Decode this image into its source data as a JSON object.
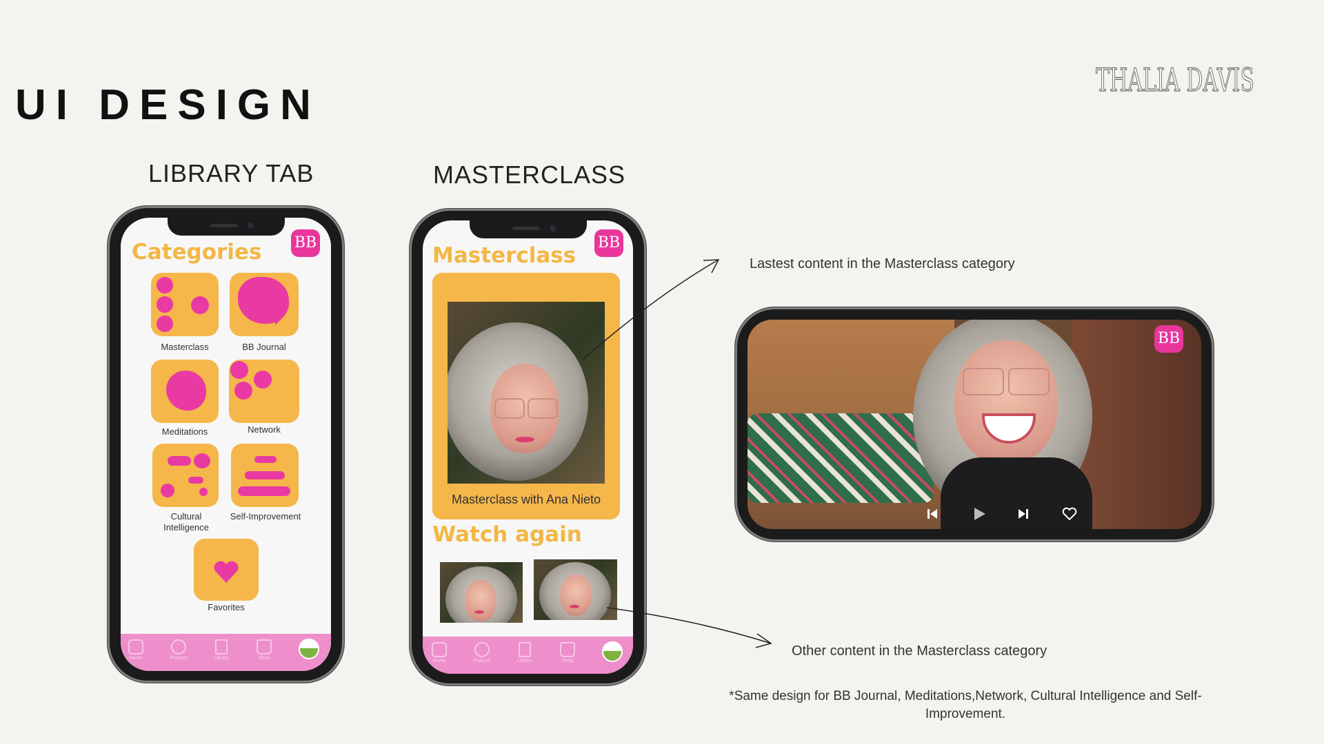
{
  "page": {
    "title": "UI DESIGN",
    "signature": "THALIA DAVIS"
  },
  "library_tab": {
    "section_title": "LIBRARY TAB",
    "heading": "Categories",
    "brand_badge": "BB",
    "categories": [
      {
        "label": "Masterclass"
      },
      {
        "label": "BB Journal"
      },
      {
        "label": "Meditations"
      },
      {
        "label": "Network"
      },
      {
        "label": "Cultural Intelligence"
      },
      {
        "label": "Self-Improvement"
      },
      {
        "label": "Favorites"
      }
    ]
  },
  "masterclass": {
    "section_title": "MASTERCLASS",
    "heading": "Masterclass",
    "brand_badge": "BB",
    "featured_caption": "Masterclass with Ana Nieto",
    "watch_again_heading": "Watch again"
  },
  "video_player": {
    "brand_badge": "BB",
    "controls": [
      "previous-icon",
      "play-icon",
      "next-icon",
      "heart-icon"
    ]
  },
  "nav": {
    "items": [
      {
        "label": "Home",
        "icon": "home-icon"
      },
      {
        "label": "Podcast",
        "icon": "podcast-icon"
      },
      {
        "label": "Library",
        "icon": "book-icon"
      },
      {
        "label": "Shop",
        "icon": "bag-icon"
      },
      {
        "label": "Profile",
        "icon": "avatar"
      }
    ]
  },
  "annotations": {
    "latest": "Lastest content in the Masterclass category",
    "other": "Other content in the Masterclass category",
    "footnote": "*Same design for BB Journal, Meditations,Network, Cultural  Intelligence  and Self-Improvement."
  },
  "colors": {
    "accent_yellow": "#f3b745",
    "accent_pink": "#e93aa3",
    "nav_pink": "#ee8fcc",
    "background": "#f5f3ef"
  }
}
